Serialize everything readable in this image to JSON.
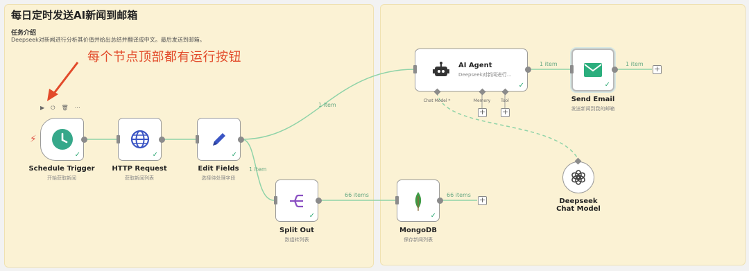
{
  "title": "每日定时发送AI新闻到邮箱",
  "task": {
    "label": "任务介绍",
    "description": "Deepseek对新闻进行分析其价值并给出总结并翻译成中文。最后发送到邮箱。"
  },
  "annotation": "每个节点顶部都有运行按钮",
  "toolbar": {
    "play": "▶",
    "power": "⏻",
    "trash": "🗑",
    "more": "⋯"
  },
  "nodes": {
    "schedule": {
      "label": "Schedule Trigger",
      "sub": "开始获取新闻"
    },
    "http": {
      "label": "HTTP Request",
      "sub": "获取新闻列表"
    },
    "edit": {
      "label": "Edit Fields",
      "sub": "选择待处理字段"
    },
    "split": {
      "label": "Split Out",
      "sub": "数组转列表"
    },
    "mongo": {
      "label": "MongoDB",
      "sub": "保存新闻列表"
    },
    "agent": {
      "label": "AI Agent",
      "sub": "Deepseek对新闻进行..."
    },
    "email": {
      "label": "Send Email",
      "sub": "发送新闻到我的邮箱"
    },
    "deepseek": {
      "label": "Deepseek Chat Model"
    }
  },
  "agent_ports": {
    "chat_model": "Chat Model *",
    "memory": "Memory",
    "tool": "Tool"
  },
  "edges": {
    "edit_agent": "1 item",
    "edit_split": "1 item",
    "split_mongo": "66 items",
    "mongo_out": "66 items",
    "agent_email": "1 item",
    "email_out": "1 item"
  },
  "check": "✓",
  "plus": "+",
  "colors": {
    "panel": "#fbf2d4",
    "success": "#2aa772",
    "wire": "#8fd3a8",
    "annotation": "#e24a2a"
  }
}
